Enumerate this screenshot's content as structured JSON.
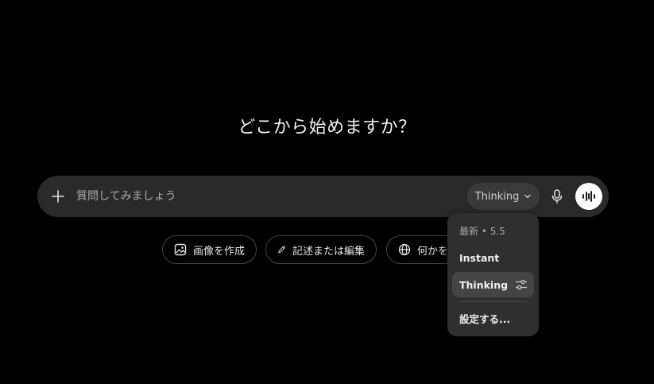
{
  "heading": "どこから始めますか？",
  "composer": {
    "placeholder": "質問してみましょう",
    "model_label": "Thinking",
    "icons": {
      "add": "plus-icon",
      "model_dropdown": "chevron-down-icon",
      "mic": "microphone-icon",
      "voice": "voice-waveform-icon"
    }
  },
  "suggestions": [
    {
      "label": "画像を作成",
      "icon": "image-icon"
    },
    {
      "label": "記述または編集",
      "icon": "pencil-icon"
    },
    {
      "label": "何かを調",
      "icon": "globe-icon"
    }
  ],
  "model_menu": {
    "header": "最新 • 5.5",
    "items": [
      {
        "label": "Instant",
        "selected": false
      },
      {
        "label": "Thinking",
        "selected": true,
        "icon": "sliders-icon"
      }
    ],
    "settings_label": "設定する..."
  },
  "colors": {
    "background": "#000000",
    "composer": "#2a2a2a",
    "menu": "#2f2f2f",
    "selected_item": "#444444"
  }
}
